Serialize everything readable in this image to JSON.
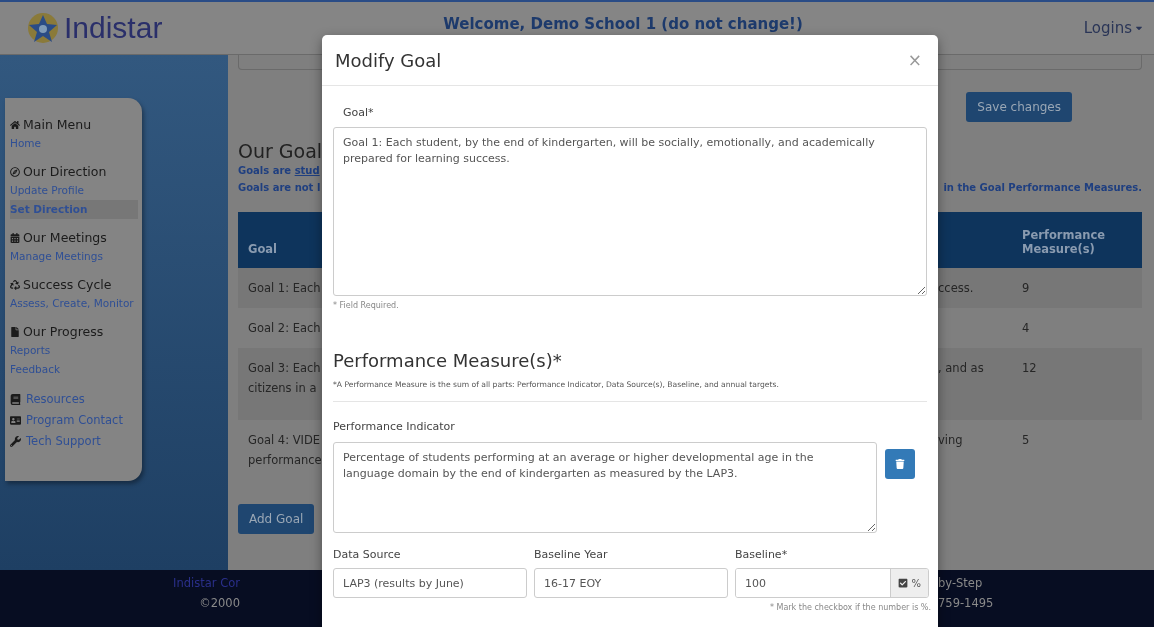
{
  "header": {
    "logo_text": "Indistar",
    "welcome": "Welcome, Demo School 1 (do not change!)",
    "logins": "Logins"
  },
  "sidebar": {
    "sections": [
      {
        "heading": "Main Menu",
        "links": [
          {
            "label": "Home",
            "selected": false
          }
        ]
      },
      {
        "heading": "Our Direction",
        "links": [
          {
            "label": "Update Profile",
            "selected": false
          },
          {
            "label": "Set Direction",
            "selected": true
          }
        ]
      },
      {
        "heading": "Our Meetings",
        "links": [
          {
            "label": "Manage Meetings",
            "selected": false
          }
        ]
      },
      {
        "heading": "Success Cycle",
        "links": [
          {
            "label": "Assess, Create, Monitor",
            "selected": false
          }
        ]
      },
      {
        "heading": "Our Progress",
        "links": [
          {
            "label": "Reports",
            "selected": false
          },
          {
            "label": "Feedback",
            "selected": false
          }
        ]
      }
    ],
    "extra_links": [
      "Resources",
      "Program Contact",
      "Tech Support"
    ]
  },
  "page": {
    "save_button": "Save changes",
    "title": "Our Goal",
    "note_1": "Goals are **stud**",
    "note_2": "Goals are not l",
    "note_right": "in the Goal Performance Measures.",
    "table": {
      "columns": [
        "Goal",
        "Performance Measure(s)"
      ],
      "rows": [
        {
          "goal_start": "Goal 1: Each",
          "goal_end": "ccess.",
          "measures": "9"
        },
        {
          "goal_start": "Goal 2: Each",
          "measures": "4"
        },
        {
          "goal_start": "Goal 3: Each",
          "goal_start_2": "citizens in a",
          "goal_end": ", and as",
          "measures": "12"
        },
        {
          "goal_start": "Goal 4: VIDE",
          "goal_start_2": "performance",
          "goal_end": "ving",
          "measures": "5"
        }
      ]
    },
    "add_button": "Add Goal"
  },
  "footer": {
    "left_1": "Indistar Cor",
    "left_2": "©2000",
    "right_1": "by-Step",
    "right_2": "759-1495"
  },
  "modal": {
    "title": "Modify Goal",
    "close": "×",
    "goal_label": "Goal*",
    "goal_value": "Goal 1: Each student, by the end of kindergarten, will be socially, emotionally, and academically prepared for learning success.",
    "required_note": "* Field Required.",
    "section_title": "Performance Measure(s)*",
    "section_note": "*A Performance Measure is the sum of all parts: Performance Indicator, Data Source(s), Baseline, and annual targets.",
    "indicator_label": "Performance Indicator",
    "indicator_value": "Percentage of students performing at an average or higher developmental age in the language domain by the end of kindergarten as measured by the LAP3.",
    "fields": [
      {
        "label": "Data Source",
        "value": "LAP3 (results by June)"
      },
      {
        "label": "Baseline Year",
        "value": "16-17 EOY"
      },
      {
        "label": "Baseline*",
        "value": "100"
      }
    ],
    "percent": {
      "label": "%",
      "checked": true
    },
    "percent_hint": "* Mark the checkbox if the number is %."
  }
}
